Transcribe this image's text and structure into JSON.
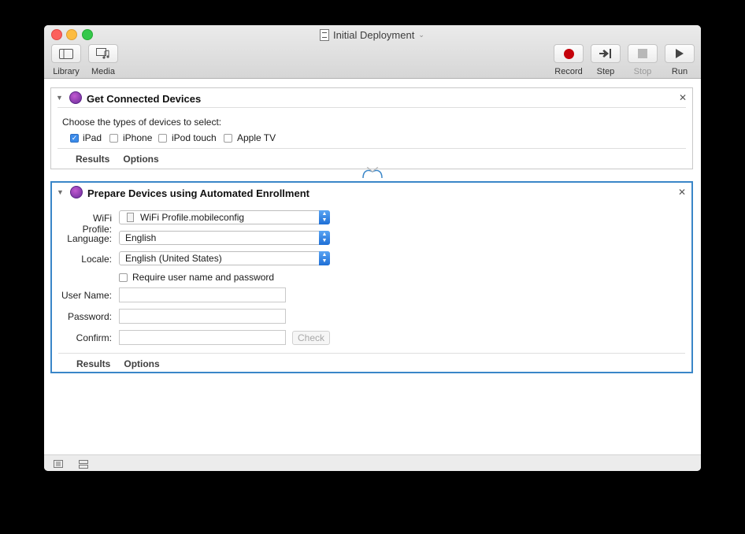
{
  "window": {
    "title": "Initial Deployment"
  },
  "toolbar": {
    "library": "Library",
    "media": "Media",
    "record": "Record",
    "step": "Step",
    "stop": "Stop",
    "run": "Run"
  },
  "actions": [
    {
      "title": "Get Connected Devices",
      "prompt": "Choose the types of devices to select:",
      "devices": [
        {
          "label": "iPad",
          "checked": true
        },
        {
          "label": "iPhone",
          "checked": false
        },
        {
          "label": "iPod touch",
          "checked": false
        },
        {
          "label": "Apple TV",
          "checked": false
        }
      ],
      "tabs": [
        "Results",
        "Options"
      ]
    },
    {
      "title": "Prepare Devices using Automated Enrollment",
      "wifi_label": "WiFi Profile:",
      "wifi_value": "WiFi Profile.mobileconfig",
      "language_label": "Language:",
      "language_value": "English",
      "locale_label": "Locale:",
      "locale_value": "English (United States)",
      "require_label": "Require user name and password",
      "username_label": "User Name:",
      "password_label": "Password:",
      "confirm_label": "Confirm:",
      "check_label": "Check",
      "tabs": [
        "Results",
        "Options"
      ]
    }
  ],
  "colors": {
    "selected_border": "#3a86c8",
    "record_red": "#c4000a",
    "checkbox_blue": "#3b8bea"
  }
}
